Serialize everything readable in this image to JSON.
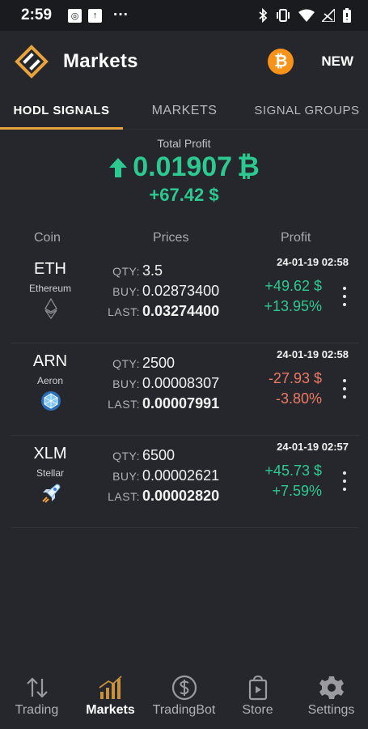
{
  "status_bar": {
    "time": "2:59",
    "more": "···"
  },
  "app_bar": {
    "title": "Markets",
    "btc_badge": "₿",
    "new_label": "NEW"
  },
  "tabs": [
    {
      "label": "HODL SIGNALS",
      "active": true
    },
    {
      "label": "MARKETS",
      "active": false
    },
    {
      "label": "SIGNAL GROUPS",
      "active": false
    }
  ],
  "summary": {
    "label": "Total Profit",
    "btc_value": "0.01907",
    "btc_symbol": "₿",
    "usd_value": "+67.42 $"
  },
  "columns": {
    "coin": "Coin",
    "prices": "Prices",
    "profit": "Profit"
  },
  "price_labels": {
    "qty": "QTY:",
    "buy": "BUY:",
    "last": "LAST:"
  },
  "coins": [
    {
      "symbol": "ETH",
      "name": "Ethereum",
      "icon": "ethereum-icon",
      "qty": "3.5",
      "buy": "0.02873400",
      "last": "0.03274400",
      "timestamp": "24-01-19 02:58",
      "profit_usd": "+49.62 $",
      "profit_pct": "+13.95%",
      "trend": "positive"
    },
    {
      "symbol": "ARN",
      "name": "Aeron",
      "icon": "aeron-icon",
      "qty": "2500",
      "buy": "0.00008307",
      "last": "0.00007991",
      "timestamp": "24-01-19 02:58",
      "profit_usd": "-27.93 $",
      "profit_pct": "-3.80%",
      "trend": "negative"
    },
    {
      "symbol": "XLM",
      "name": "Stellar",
      "icon": "stellar-icon",
      "qty": "6500",
      "buy": "0.00002621",
      "last": "0.00002820",
      "timestamp": "24-01-19 02:57",
      "profit_usd": "+45.73 $",
      "profit_pct": "+7.59%",
      "trend": "positive"
    }
  ],
  "bottom_nav": [
    {
      "label": "Trading",
      "icon": "trading-arrows-icon",
      "active": false
    },
    {
      "label": "Markets",
      "icon": "markets-bars-icon",
      "active": true
    },
    {
      "label": "TradingBot",
      "icon": "dollar-circle-icon",
      "active": false
    },
    {
      "label": "Store",
      "icon": "store-bag-icon",
      "active": false
    },
    {
      "label": "Settings",
      "icon": "gear-icon",
      "active": false
    }
  ],
  "colors": {
    "background": "#26272c",
    "accent": "#e8a33d",
    "positive": "#2ec990",
    "negative": "#ec7a63",
    "bitcoin": "#f7931a"
  }
}
